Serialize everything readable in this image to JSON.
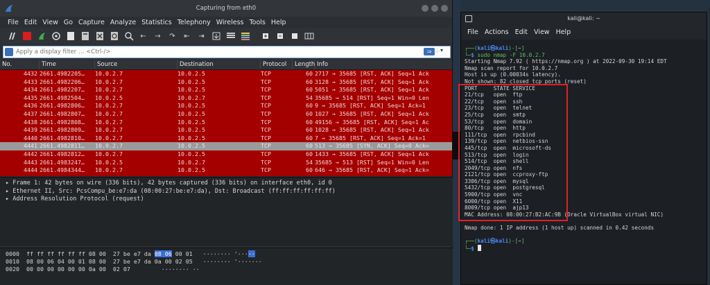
{
  "wireshark": {
    "title": "Capturing from eth0",
    "menu": [
      "File",
      "Edit",
      "View",
      "Go",
      "Capture",
      "Analyze",
      "Statistics",
      "Telephony",
      "Wireless",
      "Tools",
      "Help"
    ],
    "filter_placeholder": "Apply a display filter … <Ctrl-/>",
    "columns": [
      "No.",
      "Time",
      "Source",
      "Destination",
      "Protocol",
      "Length",
      "Info"
    ],
    "packets": [
      {
        "no": "4432",
        "time": "2661.4982205…",
        "src": "10.0.2.7",
        "dst": "10.0.2.5",
        "proto": "TCP",
        "len": "60",
        "info": "2717 → 35685 [RST, ACK] Seq=1 Ack"
      },
      {
        "no": "4433",
        "time": "2661.4982206…",
        "src": "10.0.2.7",
        "dst": "10.0.2.5",
        "proto": "TCP",
        "len": "60",
        "info": "3128 → 35685 [RST, ACK] Seq=1 Ack"
      },
      {
        "no": "4434",
        "time": "2661.4982207…",
        "src": "10.0.2.7",
        "dst": "10.0.2.5",
        "proto": "TCP",
        "len": "60",
        "info": "5051 → 35685 [RST, ACK] Seq=1 Ack"
      },
      {
        "no": "4435",
        "time": "2661.4982504…",
        "src": "10.0.2.5",
        "dst": "10.0.2.7",
        "proto": "TCP",
        "len": "54",
        "info": "35685 → 514 [RST] Seq=1 Win=0 Len"
      },
      {
        "no": "4436",
        "time": "2661.4982806…",
        "src": "10.0.2.7",
        "dst": "10.0.2.5",
        "proto": "TCP",
        "len": "60",
        "info": "9 → 35685 [RST, ACK] Seq=1 Ack=1"
      },
      {
        "no": "4437",
        "time": "2661.4982807…",
        "src": "10.0.2.7",
        "dst": "10.0.2.5",
        "proto": "TCP",
        "len": "60",
        "info": "1027 → 35685 [RST, ACK] Seq=1 Ack"
      },
      {
        "no": "4438",
        "time": "2661.4982808…",
        "src": "10.0.2.7",
        "dst": "10.0.2.5",
        "proto": "TCP",
        "len": "60",
        "info": "49156 → 35685 [RST, ACK] Seq=1 Ac"
      },
      {
        "no": "4439",
        "time": "2661.4982809…",
        "src": "10.0.2.7",
        "dst": "10.0.2.5",
        "proto": "TCP",
        "len": "60",
        "info": "1028 → 35685 [RST, ACK] Seq=1 Ack"
      },
      {
        "no": "4440",
        "time": "2661.4982810…",
        "src": "10.0.2.7",
        "dst": "10.0.2.5",
        "proto": "TCP",
        "len": "60",
        "info": "7 → 35685 [RST, ACK] Seq=1 Ack=1"
      },
      {
        "no": "4441",
        "time": "2661.4982811…",
        "src": "10.0.2.7",
        "dst": "10.0.2.5",
        "proto": "TCP",
        "len": "60",
        "info": "513 → 35685 [SYN, ACK] Seq=0 Ack="
      },
      {
        "no": "4442",
        "time": "2661.4982812…",
        "src": "10.0.2.7",
        "dst": "10.0.2.5",
        "proto": "TCP",
        "len": "60",
        "info": "1433 → 35685 [RST, ACK] Seq=1 Ack"
      },
      {
        "no": "4443",
        "time": "2661.4983247…",
        "src": "10.0.2.5",
        "dst": "10.0.2.7",
        "proto": "TCP",
        "len": "54",
        "info": "35685 → 513 [RST] Seq=1 Win=0 Len"
      },
      {
        "no": "4444",
        "time": "2661.4984344…",
        "src": "10.0.2.7",
        "dst": "10.0.2.5",
        "proto": "TCP",
        "len": "60",
        "info": "646 → 35685 [RST, ACK] Seq=1 Ack="
      }
    ],
    "selected_row": "4441",
    "details": [
      "▸ Frame 1: 42 bytes on wire (336 bits), 42 bytes captured (336 bits) on interface eth0, id 0",
      "▸ Ethernet II, Src: PcsCompu_be:e7:da (08:00:27:be:e7:da), Dst: Broadcast (ff:ff:ff:ff:ff:ff)",
      "▸ Address Resolution Protocol (request)"
    ],
    "bytes": [
      {
        "offset": "0000",
        "hex_a": "ff ff ff ff ff ff 08 00  27 be e7 da ",
        "hex_hl": "08 06",
        "hex_b": " 00 01",
        "ascii_a": "   ········ '···",
        "ascii_hl": "··",
        "ascii_b": ""
      },
      {
        "offset": "0010",
        "hex_a": "08 00 06 04 00 01 08 00  27 be e7 da 0a 00 02 05",
        "hex_hl": "",
        "hex_b": "",
        "ascii_a": "   ········ '·······",
        "ascii_hl": "",
        "ascii_b": ""
      },
      {
        "offset": "0020",
        "hex_a": "00 00 00 00 00 00 0a 00  02 07",
        "hex_hl": "",
        "hex_b": "",
        "ascii_a": "         ········ ··",
        "ascii_hl": "",
        "ascii_b": ""
      }
    ]
  },
  "terminal": {
    "title": "kali@kali: ~",
    "menu": [
      "File",
      "Actions",
      "Edit",
      "View",
      "Help"
    ],
    "prompt_user": "kali",
    "prompt_host": "kali",
    "prompt_dir": "~",
    "command": "sudo nmap -F 10.0.2.7",
    "output_head": [
      "Starting Nmap 7.92 ( https://nmap.org ) at 2022-09-30 19:14 EDT",
      "Nmap scan report for 10.0.2.7",
      "Host is up (0.00034s latency).",
      "Not shown: 82 closed tcp ports (reset)"
    ],
    "ports_header": "PORT     STATE SERVICE",
    "ports": [
      "21/tcp   open  ftp",
      "22/tcp   open  ssh",
      "23/tcp   open  telnet",
      "25/tcp   open  smtp",
      "53/tcp   open  domain",
      "80/tcp   open  http",
      "111/tcp  open  rpcbind",
      "139/tcp  open  netbios-ssn",
      "445/tcp  open  microsoft-ds",
      "513/tcp  open  login",
      "514/tcp  open  shell",
      "2049/tcp open  nfs",
      "2121/tcp open  ccproxy-ftp",
      "3306/tcp open  mysql",
      "5432/tcp open  postgresql",
      "5900/tcp open  vnc",
      "6000/tcp open  X11",
      "8009/tcp open  ajp13"
    ],
    "mac_line": "MAC Address: 08:00:27:B2:AC:9B (Oracle VirtualBox virtual NIC)",
    "done_line": "Nmap done: 1 IP address (1 host up) scanned in 0.42 seconds"
  },
  "colors": {
    "packet_red": "#a40000",
    "selected_gray": "#9a9a9a",
    "highlight_box": "#e1202a",
    "kali_blue": "#4a8af4",
    "prompt_green": "#63c15f"
  }
}
